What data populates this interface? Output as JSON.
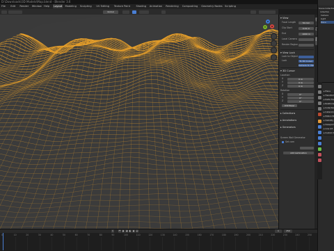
{
  "window": {
    "title": "D:\\Downloads\\3D Models\\Map.blend - Blender 3.6"
  },
  "workspaces": [
    {
      "label": "File"
    },
    {
      "label": "Edit"
    },
    {
      "label": "Render"
    },
    {
      "label": "Window"
    },
    {
      "label": "Help"
    },
    {
      "label": "Layout"
    },
    {
      "label": "Modeling"
    },
    {
      "label": "Sculpting"
    },
    {
      "label": "UV Editing"
    },
    {
      "label": "Texture Paint"
    },
    {
      "label": "Shading"
    },
    {
      "label": "Animation"
    },
    {
      "label": "Rendering"
    },
    {
      "label": "Compositing"
    },
    {
      "label": "Geometry Nodes"
    },
    {
      "label": "Scripting"
    }
  ],
  "viewport_header": {
    "mode": "Edit Mode",
    "transform": "Global"
  },
  "colors": {
    "wire": "#e8a02a",
    "terrain_dark": "#2a2a2a",
    "accent_blue": "#4a7fd4",
    "axis_x": "#d2453f",
    "axis_y": "#7bb326",
    "axis_z": "#3c79d6"
  },
  "sidebar": {
    "tabs": [
      "Item",
      "Tool",
      "View"
    ],
    "view_section": "View",
    "fields": [
      {
        "label": "Focal Length",
        "value": "50 mm"
      },
      {
        "label": "Clip Start",
        "value": "0.01 m"
      },
      {
        "label": "End",
        "value": "1000 m"
      },
      {
        "label": "Local Camera",
        "value": ""
      },
      {
        "label": "Render Region",
        "value": ""
      }
    ],
    "view_lock": "View Lock",
    "lock_fields": [
      {
        "label": "Lock to Object",
        "value": ""
      },
      {
        "label": "Lock",
        "value": "To 3D Cursor"
      },
      {
        "label": "",
        "value": "Camera to View"
      }
    ],
    "cursor_section": "3D Cursor",
    "cursor_location_label": "Location",
    "cursor_location": [
      {
        "axis": "X",
        "value": "0 m"
      },
      {
        "axis": "Y",
        "value": "0 m"
      },
      {
        "axis": "Z",
        "value": "0 m"
      }
    ],
    "cursor_rotation_label": "Rotation",
    "cursor_rotation": [
      {
        "axis": "X",
        "value": "0°"
      },
      {
        "axis": "Y",
        "value": "0°"
      },
      {
        "axis": "Z",
        "value": "0°"
      }
    ],
    "rotation_mode": "XYZ Euler",
    "collapsed": [
      {
        "label": "Collections"
      },
      {
        "label": "Annotations"
      },
      {
        "label": "Generators"
      }
    ],
    "addon_label": "Screen Wall Generator",
    "addon_check": "Set cam",
    "addon_button": "Add Lamination"
  },
  "outliner": {
    "items": [
      {
        "label": "Scene Collection"
      },
      {
        "label": "Collection"
      },
      {
        "label": "Camera"
      },
      {
        "label": "Light"
      },
      {
        "label": "Plane"
      }
    ]
  },
  "properties": {
    "items": [
      {
        "label": "Plane"
      },
      {
        "label": "Transform"
      },
      {
        "label": "Delta Transform"
      },
      {
        "label": "Relations"
      },
      {
        "label": "Collections"
      },
      {
        "label": "Instancing"
      },
      {
        "label": "Motion Paths"
      },
      {
        "label": "Visibility"
      },
      {
        "label": "Viewport Display"
      },
      {
        "label": "Line Art"
      },
      {
        "label": "Custom Properties"
      }
    ]
  },
  "timeline": {
    "current_frame": "1",
    "start": "1",
    "end": "250",
    "frames": [
      "0",
      "10",
      "20",
      "30",
      "40",
      "50",
      "60",
      "70",
      "80",
      "90",
      "100",
      "110",
      "120",
      "130",
      "140",
      "150",
      "160",
      "170",
      "180",
      "190",
      "200",
      "210",
      "220",
      "230",
      "240",
      "250"
    ]
  }
}
